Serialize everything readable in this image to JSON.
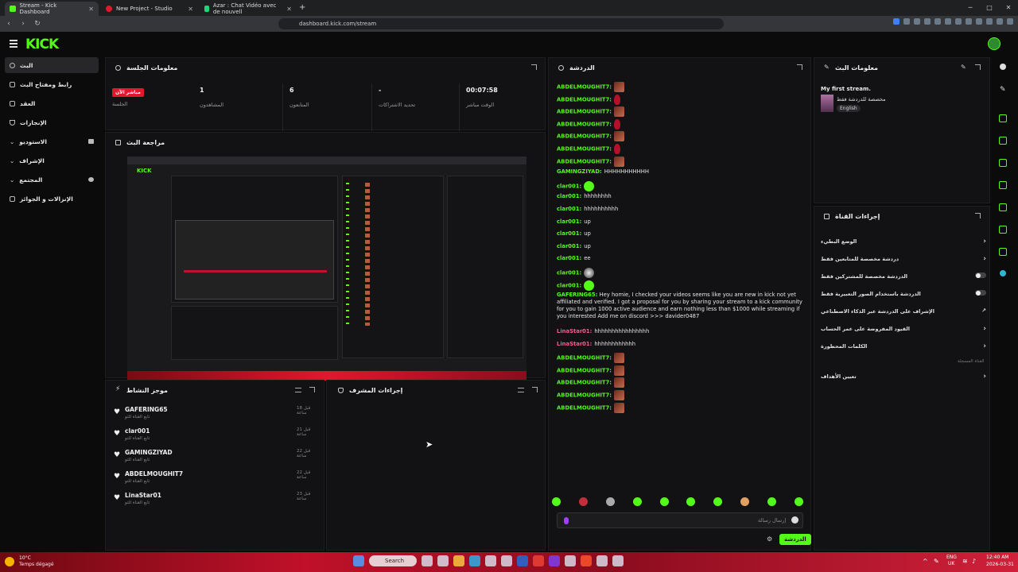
{
  "browser": {
    "tabs": [
      {
        "label": "Stream - Kick Dashboard",
        "active": true
      },
      {
        "label": "New Project - Studio",
        "active": false
      },
      {
        "label": "Azar : Chat Vidéo avec de nouvell",
        "active": false
      }
    ],
    "url": "dashboard.kick.com/stream"
  },
  "header": {
    "logo": "KICK"
  },
  "sidebar": {
    "items": [
      {
        "label": "البث"
      },
      {
        "label": "رابط ومفتاح البث"
      },
      {
        "label": "العقد"
      },
      {
        "label": "الإنجازات"
      },
      {
        "label": "الاستوديو"
      },
      {
        "label": "الإشراف"
      },
      {
        "label": "المجتمع"
      },
      {
        "label": "الإنزالات و الجوائز"
      }
    ]
  },
  "session": {
    "title": "معلومات الجلسة",
    "live_badge": "مباشر الآن",
    "session_label": "الجلسة",
    "stats": [
      {
        "value": "1",
        "label": "المشاهدون"
      },
      {
        "value": "6",
        "label": "المتابعون"
      },
      {
        "value": "-",
        "label": "تحديد الاشتراكات"
      },
      {
        "value": "00:07:58",
        "label": "الوقت مباشر"
      }
    ]
  },
  "preview": {
    "title": "مراجعة البث"
  },
  "activity": {
    "title": "موجز النشاط",
    "items": [
      {
        "name": "GAFERING65",
        "sub": "تابع القناة للتو",
        "time": "قبل 18 ساعة"
      },
      {
        "name": "clar001",
        "sub": "تابع القناة للتو",
        "time": "قبل 21 ساعة"
      },
      {
        "name": "GAMINGZIYAD",
        "sub": "تابع القناة للتو",
        "time": "قبل 22 ساعة"
      },
      {
        "name": "ABDELMOUGHIT7",
        "sub": "تابع القناة للتو",
        "time": "قبل 22 ساعة"
      },
      {
        "name": "LinaStar01",
        "sub": "تابع القناة للتو",
        "time": "قبل 23 ساعة"
      }
    ]
  },
  "mod": {
    "title": "إجراءات المشرف"
  },
  "chat": {
    "title": "الدردشة",
    "messages": [
      {
        "user": "ABDELMOUGHIT7:",
        "color": "#53fc18",
        "text": "",
        "emote": "er"
      },
      {
        "user": "ABDELMOUGHIT7:",
        "color": "#53fc18",
        "text": "",
        "emote": "erd"
      },
      {
        "user": "ABDELMOUGHIT7:",
        "color": "#53fc18",
        "text": "",
        "emote": "er"
      },
      {
        "user": "ABDELMOUGHIT7:",
        "color": "#53fc18",
        "text": "",
        "emote": "erd"
      },
      {
        "user": "ABDELMOUGHIT7:",
        "color": "#53fc18",
        "text": "",
        "emote": "er"
      },
      {
        "user": "ABDELMOUGHIT7:",
        "color": "#53fc18",
        "text": "",
        "emote": "erd"
      },
      {
        "user": "ABDELMOUGHIT7:",
        "color": "#53fc18",
        "text": "",
        "emote": "er"
      },
      {
        "user": "GAMINGZIYAD:",
        "color": "#53fc18",
        "text": "HHHHHHHHHHH",
        "emote": ""
      },
      {
        "user": "clar001:",
        "color": "#53fc18",
        "text": "",
        "emote": "eg"
      },
      {
        "user": "clar001:",
        "color": "#53fc18",
        "text": "hhhhhhhh",
        "emote": ""
      },
      {
        "user": "clar001:",
        "color": "#53fc18",
        "text": "hhhhhhhhhh",
        "emote": ""
      },
      {
        "user": "clar001:",
        "color": "#53fc18",
        "text": "up",
        "emote": ""
      },
      {
        "user": "clar001:",
        "color": "#53fc18",
        "text": "up",
        "emote": ""
      },
      {
        "user": "clar001:",
        "color": "#53fc18",
        "text": "up",
        "emote": ""
      },
      {
        "user": "clar001:",
        "color": "#53fc18",
        "text": "ee",
        "emote": ""
      },
      {
        "user": "clar001:",
        "color": "#53fc18",
        "text": "",
        "emote": "eb"
      },
      {
        "user": "clar001:",
        "color": "#53fc18",
        "text": "",
        "emote": "eg"
      }
    ],
    "long_message": {
      "user": "GAFERING65:",
      "text": "Hey homie, I checked your videos seems like you are new in kick not yet affiliated and verified. I got a proposal for you by sharing your stream to a kick community for you to gain 1000 active audience and earn nothing less than $1000 while streaming if you interested Add me on discord >>> davider0487"
    },
    "messages2": [
      {
        "user": "LinaStar01:",
        "color": "#f95891",
        "text": "hhhhhhhhhhhhhhhh",
        "emote": ""
      },
      {
        "user": "LinaStar01:",
        "color": "#f95891",
        "text": "hhhhhhhhhhhh",
        "emote": ""
      },
      {
        "user": "ABDELMOUGHIT7:",
        "color": "#53fc18",
        "text": "",
        "emote": "er"
      },
      {
        "user": "ABDELMOUGHIT7:",
        "color": "#53fc18",
        "text": "",
        "emote": "er"
      },
      {
        "user": "ABDELMOUGHIT7:",
        "color": "#53fc18",
        "text": "",
        "emote": "er"
      },
      {
        "user": "ABDELMOUGHIT7:",
        "color": "#53fc18",
        "text": "",
        "emote": "er"
      },
      {
        "user": "ABDELMOUGHIT7:",
        "color": "#53fc18",
        "text": "",
        "emote": "er"
      }
    ],
    "input_placeholder": "إرسال رسالة",
    "send_label": "الدردشة"
  },
  "stream_info": {
    "title": "معلومات البث",
    "stream_title": "My first stream.",
    "category": "مخصصة للدردشة فقط",
    "language": "English"
  },
  "channel_actions": {
    "title": "إجراءات القناة",
    "rows": [
      {
        "label": "الوضع البطيء",
        "control": "chevron"
      },
      {
        "label": "دردشة مخصصة للمتابعين فقط",
        "control": "chevron"
      },
      {
        "label": "الدردشة مخصصة للمشتركين فقط",
        "control": "toggle"
      },
      {
        "label": "الدردشة باستخدام الصور التعبيرية فقط",
        "control": "toggle"
      },
      {
        "label": "الإشراف على الدردشة عبر الذكاء الاصطناعي",
        "control": "external"
      },
      {
        "label": "القيود المفروضة على عمر الحساب",
        "control": "chevron"
      },
      {
        "label": "الكلمات المحظورة",
        "control": "chevron"
      },
      {
        "label": "تعيين الأهداف",
        "control": "chevron"
      }
    ],
    "note": "القناة المسجلة"
  },
  "taskbar": {
    "weather": "10°C",
    "weather_sub": "Temps dégagé",
    "search": "Search",
    "lang": "ENG",
    "lang_sub": "UK",
    "time": "12:40 AM",
    "date": "2026-03-31"
  },
  "colors": {
    "accent": "#53fc18",
    "live": "#e0182d",
    "bg": "#0b0b0c",
    "panel": "#121214"
  }
}
